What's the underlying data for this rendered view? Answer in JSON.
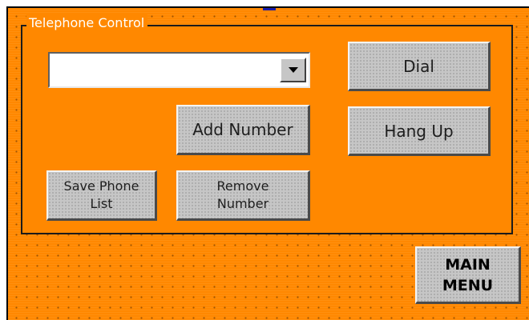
{
  "group": {
    "title": "Telephone Control"
  },
  "phone_select": {
    "value": ""
  },
  "buttons": {
    "dial": "Dial",
    "hang_up": "Hang Up",
    "add_number": "Add Number",
    "save_phone_list": "Save Phone\nList",
    "remove_number": "Remove\nNumber",
    "main_menu": "MAIN\nMENU"
  },
  "icons": {
    "dropdown": "chevron-down-icon"
  },
  "colors": {
    "background": "#ff8800",
    "button_face": "#c6c6c6",
    "group_title_text": "#ffffff"
  }
}
